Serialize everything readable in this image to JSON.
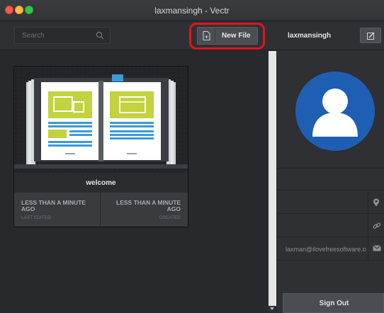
{
  "window": {
    "title": "laxmansingh - Vectr"
  },
  "toolbar": {
    "search_placeholder": "Search",
    "new_file_label": "New File"
  },
  "documents": [
    {
      "title": "welcome",
      "last_edited_value": "LESS THAN A MINUTE AGO",
      "last_edited_label": "LAST EDITED",
      "created_value": "LESS THAN A MINUTE AGO",
      "created_label": "CREATED"
    }
  ],
  "profile": {
    "username": "laxmansingh",
    "location": "",
    "website": "",
    "email": "laxman@ilovefreesoftware.com",
    "sign_out_label": "Sign Out"
  },
  "colors": {
    "accent_highlight": "#e0151b",
    "avatar_bg": "#1f5fb3",
    "thumb_green": "#c3d23f",
    "thumb_blue": "#3b9ad9"
  },
  "icons": {
    "search": "search-icon",
    "new_file": "new-file-icon",
    "edit": "edit-icon",
    "location": "location-pin-icon",
    "link": "link-icon",
    "email": "email-icon"
  }
}
